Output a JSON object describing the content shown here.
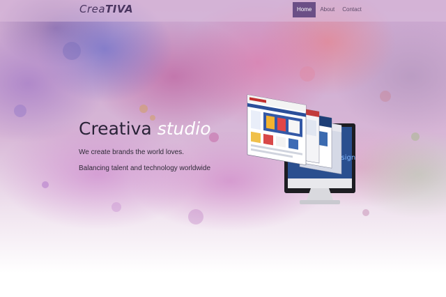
{
  "navbar": {
    "brand_part1": "Crea",
    "brand_part2": "TIVA",
    "links": [
      {
        "label": "Home",
        "active": true
      },
      {
        "label": "About",
        "active": false
      },
      {
        "label": "Contact",
        "active": false
      }
    ]
  },
  "hero": {
    "title_main": "Creativa ",
    "title_emphasis": "studio",
    "tagline_1": "We create brands the world loves.",
    "tagline_2": "Balancing talent and technology worldwide"
  },
  "illustration": {
    "icon": "responsive-web-design-illustration",
    "screen_text": "design"
  },
  "colors": {
    "nav_active_bg": "#6b4f86",
    "brand_text": "#4a3560",
    "title_text": "#2a2338",
    "accent_white": "#ffffff"
  }
}
